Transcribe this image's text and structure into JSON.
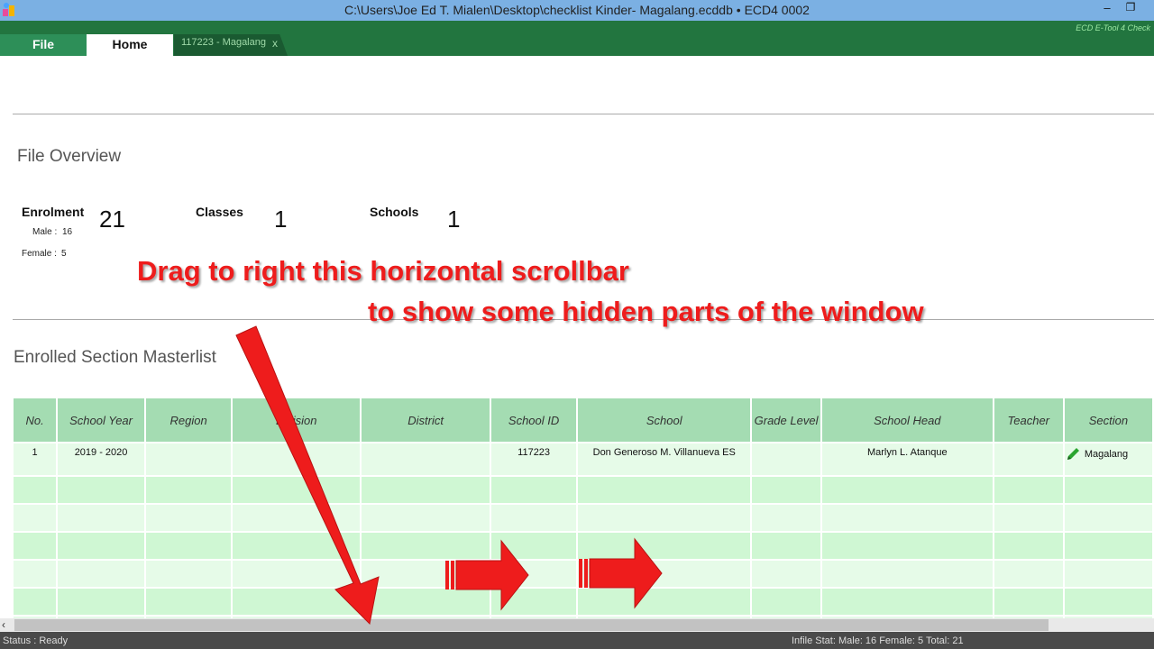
{
  "window": {
    "title": "C:\\Users\\Joe Ed T. Mialen\\Desktop\\checklist Kinder- Magalang.ecddb   •   ECD4 0002",
    "min_glyph": "–",
    "max_glyph": "❐"
  },
  "ribbon": {
    "tabs": [
      {
        "label": "File"
      },
      {
        "label": "Home"
      },
      {
        "label": "117223  -  Magalang",
        "close": "x"
      }
    ],
    "brand": "ECD E-Tool 4 Check"
  },
  "overview": {
    "title": "File Overview",
    "enrolment_label": "Enrolment",
    "enrolment_value": "21",
    "male_label": "Male :",
    "male_value": "16",
    "female_label": "Female :",
    "female_value": "5",
    "classes_label": "Classes",
    "classes_value": "1",
    "schools_label": "Schools",
    "schools_value": "1"
  },
  "masterlist": {
    "title": "Enrolled Section Masterlist",
    "columns": [
      "No.",
      "School Year",
      "Region",
      "Division",
      "District",
      "School ID",
      "School",
      "Grade Level",
      "School Head",
      "Teacher",
      "Section"
    ],
    "rows": [
      [
        "1",
        "2019 - 2020",
        "",
        "",
        "",
        "117223",
        "Don Generoso M. Villanueva ES",
        "",
        "Marlyn L. Atanque",
        "",
        "Magalang"
      ]
    ],
    "empty_rows": 6
  },
  "status": {
    "text": "Status : Ready",
    "infile": "Infile Stat:  Male: 16  Female: 5   Total: 21"
  },
  "annotation": {
    "line1": "Drag to right this horizontal scrollbar",
    "line2": "to show some hidden parts of the window"
  },
  "icons": {
    "app": "app-logo-icon",
    "edit": "pencil-edit-icon",
    "scroll_left": "chevron-left-icon"
  },
  "colors": {
    "ribbon_green": "#22753f",
    "header_green": "#a4dcb2",
    "annotation_red": "#ee1c1c",
    "titlebar_blue": "#7bb0e3"
  }
}
